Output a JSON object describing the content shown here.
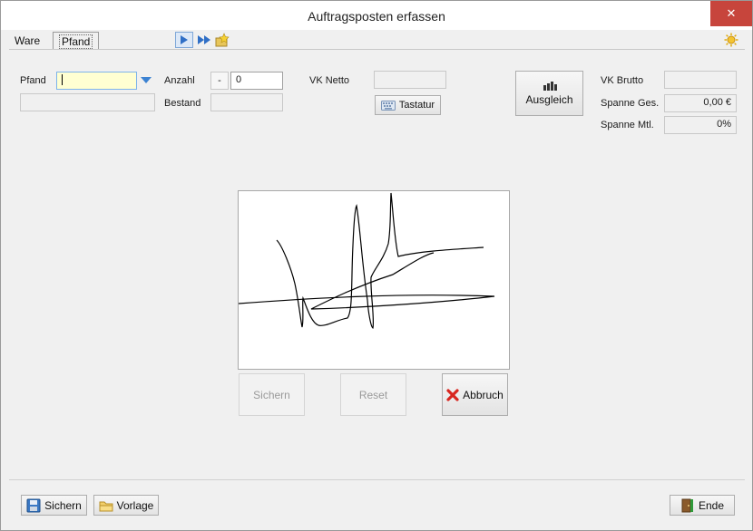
{
  "window": {
    "title": "Auftragsposten erfassen"
  },
  "tabs": [
    {
      "label": "Ware"
    },
    {
      "label": "Pfand"
    }
  ],
  "form": {
    "pfand_label": "Pfand",
    "pfand_value": "",
    "anzahl_label": "Anzahl",
    "anzahl_minus": "-",
    "anzahl_value": "0",
    "bestand_label": "Bestand",
    "bestand_value": "",
    "vk_netto_label": "VK Netto",
    "vk_netto_value": "",
    "tastatur_label": "Tastatur",
    "ausgleich_label": "Ausgleich",
    "vk_brutto_label": "VK Brutto",
    "vk_brutto_value": "",
    "spanne_ges_label": "Spanne Ges.",
    "spanne_ges_value": "0,00 €",
    "spanne_mtl_label": "Spanne Mtl.",
    "spanne_mtl_value": "0%"
  },
  "signature": {
    "sichern_label": "Sichern",
    "reset_label": "Reset",
    "abbruch_label": "Abbruch"
  },
  "footer": {
    "sichern_label": "Sichern",
    "vorlage_label": "Vorlage",
    "ende_label": "Ende"
  },
  "colors": {
    "close": "#c7453c",
    "accent": "#3c82d2",
    "input_highlight": "#ffffd2"
  }
}
